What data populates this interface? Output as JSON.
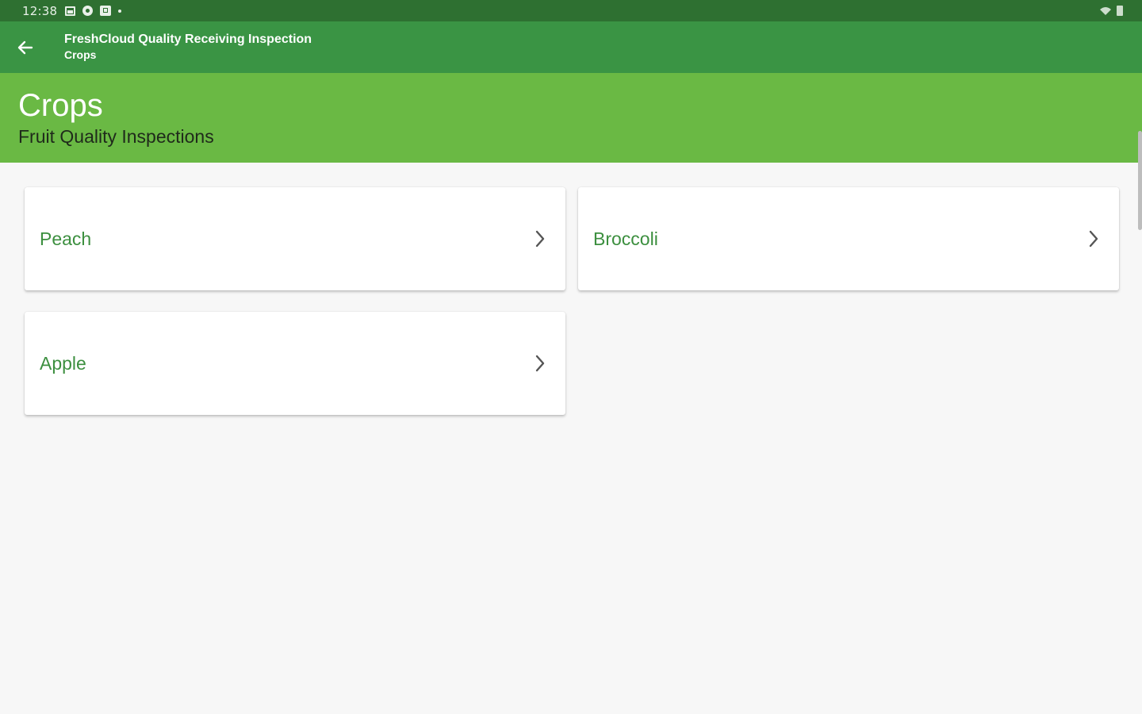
{
  "status_bar": {
    "time": "12:38",
    "left_icons": [
      "image-icon",
      "circle-status-icon",
      "box-status-icon",
      "dot-icon"
    ],
    "right_icons": [
      "wifi-icon",
      "battery-icon"
    ]
  },
  "app_bar": {
    "back_icon": "arrow-left-icon",
    "title": "FreshCloud Quality Receiving Inspection",
    "subtitle": "Crops"
  },
  "header": {
    "title": "Crops",
    "subtitle": "Fruit Quality Inspections"
  },
  "crops": [
    {
      "label": "Peach",
      "icon": "chevron-right-icon"
    },
    {
      "label": "Broccoli",
      "icon": "chevron-right-icon"
    },
    {
      "label": "Apple",
      "icon": "chevron-right-icon"
    }
  ],
  "colors": {
    "status_bar": "#2e7031",
    "app_bar": "#3a9444",
    "header_band": "#6ab944",
    "card_label": "#3c8f3f",
    "background": "#f7f7f7"
  }
}
